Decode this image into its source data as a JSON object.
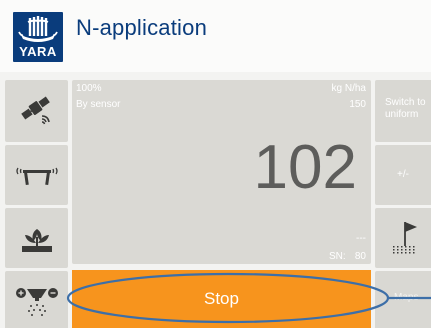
{
  "header": {
    "logo_text": "YARA",
    "title": "N-application"
  },
  "display": {
    "percent": "100%",
    "unit": "kg N/ha",
    "mode": "By sensor",
    "target": "150",
    "value": "102",
    "dashes": "---",
    "sn_label": "SN:",
    "sn_value": "80"
  },
  "right_panel": {
    "switch_label": "Switch to uniform",
    "plusminus_label": "+/-",
    "maps_label": "Maps"
  },
  "action": {
    "stop_label": "Stop"
  },
  "icons": {
    "satellite": "satellite-icon",
    "boom_sensor": "boom-sensor-icon",
    "crop": "crop-icon",
    "spreader": "spreader-icon",
    "flag_field": "flag-field-icon"
  },
  "colors": {
    "brand": "#0a3c7c",
    "stop": "#f7941d",
    "panel": "#d9d8d3",
    "highlight_ring": "#3d6fa8"
  }
}
